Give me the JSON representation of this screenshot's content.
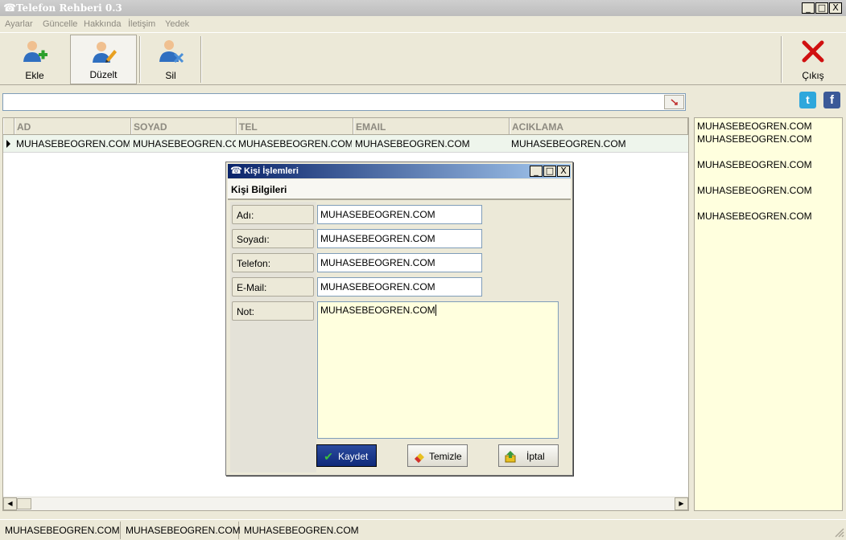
{
  "window": {
    "title": "Telefon Rehberi 0.3",
    "icon": "phone-icon",
    "controls": {
      "minimize": "_",
      "maximize": "□",
      "close": "X"
    }
  },
  "menu": [
    "Ayarlar",
    "Güncelle",
    "Hakkında",
    "İletişim",
    "Yedek"
  ],
  "toolbar": {
    "add": "Ekle",
    "edit": "Düzelt",
    "delete": "Sil",
    "exit": "Çıkış"
  },
  "search": {
    "value": ""
  },
  "social": {
    "twitter": "t",
    "facebook": "f"
  },
  "grid": {
    "columns": [
      "AD",
      "SOYAD",
      "TEL",
      "EMAIL",
      "ACIKLAMA"
    ],
    "rows": [
      [
        "MUHASEBEOGREN.COM",
        "MUHASEBEOGREN.COM",
        "MUHASEBEOGREN.COM",
        "MUHASEBEOGREN.COM",
        "MUHASEBEOGREN.COM"
      ]
    ]
  },
  "side_list": [
    "MUHASEBEOGREN.COM",
    "MUHASEBEOGREN.COM",
    "MUHASEBEOGREN.COM",
    "MUHASEBEOGREN.COM",
    "MUHASEBEOGREN.COM"
  ],
  "status": [
    "MUHASEBEOGREN.COM",
    "MUHASEBEOGREN.COM",
    "MUHASEBEOGREN.COM"
  ],
  "dialog": {
    "title": "Kişi İşlemleri",
    "header": "Kişi Bilgileri",
    "fields": {
      "name": {
        "label": "Adı:",
        "value": "MUHASEBEOGREN.COM"
      },
      "surname": {
        "label": "Soyadı:",
        "value": "MUHASEBEOGREN.COM"
      },
      "phone": {
        "label": "Telefon:",
        "value": "MUHASEBEOGREN.COM"
      },
      "email": {
        "label": "E-Mail:",
        "value": "MUHASEBEOGREN.COM"
      },
      "note": {
        "label": "Not:",
        "value": "MUHASEBEOGREN.COM"
      }
    },
    "buttons": {
      "save": "Kaydet",
      "clear": "Temizle",
      "cancel": "İptal"
    }
  },
  "colors": {
    "accent": "#0a246a",
    "note_bg": "#ffffde",
    "row_bg": "#eef5ec",
    "exit_red": "#d01010"
  }
}
